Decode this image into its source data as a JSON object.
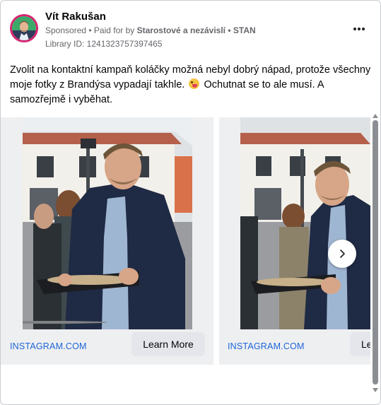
{
  "post": {
    "author": "Vít Rakušan",
    "sponsored": "Sponsored",
    "paid_prefix": " • Paid for by ",
    "paid_by": "Starostové a nezávislí • STAN",
    "library_id": "Library ID: 1241323757397465",
    "text_part1": "Zvolit na kontaktní kampaň koláčky možná nebyl dobrý nápad, protože všechny moje fotky z Brandýsa vypadají takhle.",
    "text_part2": "Ochutnat se to ale musí. A samozřejmě i vyběhat."
  },
  "icons": {
    "more": "more-horizontal-icon",
    "emoji": "tongue-out-emoji-icon",
    "next": "chevron-right-icon"
  },
  "carousel": {
    "cards": [
      {
        "link": "INSTAGRAM.COM",
        "cta": "Learn More"
      },
      {
        "link": "INSTAGRAM.COM",
        "cta": "Learn More"
      }
    ]
  },
  "colors": {
    "link": "#1d65d6",
    "avatar_ring": "#d6246e",
    "button_bg": "#e4e6eb"
  }
}
